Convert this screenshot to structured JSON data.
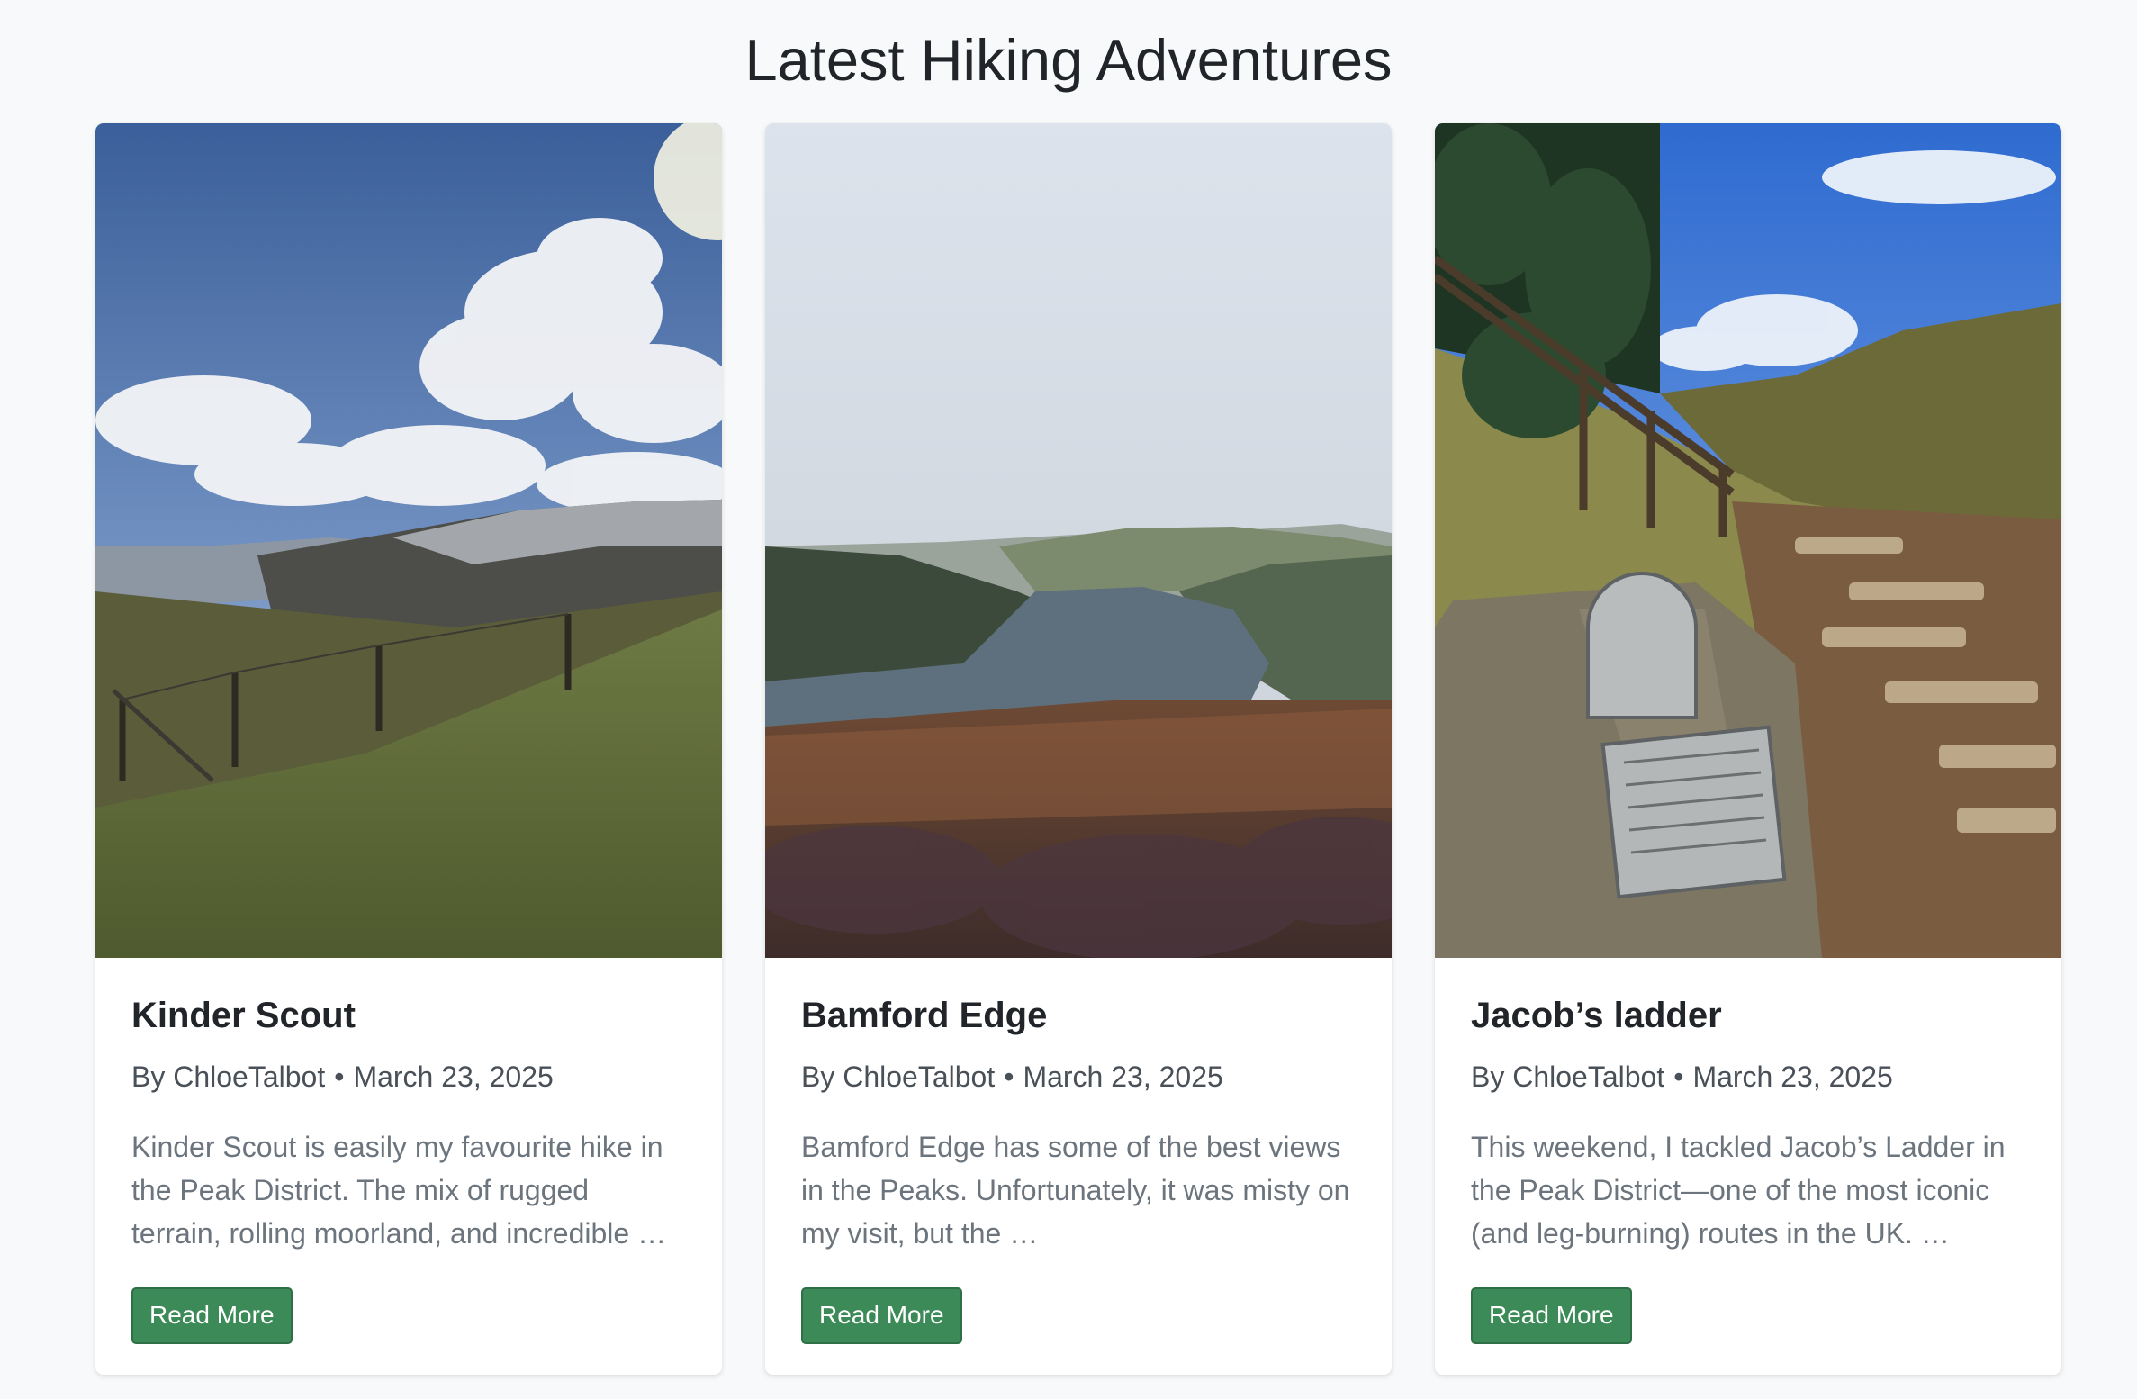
{
  "header": {
    "title": "Latest Hiking Adventures"
  },
  "posts": [
    {
      "title": "Kinder Scout",
      "by_label": "By",
      "author": "ChloeTalbot",
      "separator": "•",
      "date": "March 23, 2025",
      "excerpt": "Kinder Scout is easily my favourite hike in the Peak District. The mix of rugged terrain, rolling moorland, and incredible …",
      "button_label": "Read More",
      "image": "moorland-hills-cloudy-sky-photo"
    },
    {
      "title": "Bamford Edge",
      "by_label": "By",
      "author": "ChloeTalbot",
      "separator": "•",
      "date": "March 23, 2025",
      "excerpt": "Bamford Edge has some of the best views in the Peaks. Unfortunately, it was misty on my visit, but the …",
      "button_label": "Read More",
      "image": "misty-reservoir-valley-photo"
    },
    {
      "title": "Jacob’s ladder",
      "by_label": "By",
      "author": "ChloeTalbot",
      "separator": "•",
      "date": "March 23, 2025",
      "excerpt": "This weekend, I tackled Jacob’s Ladder in the Peak District—one of the most iconic (and leg-burning) routes in the UK. …",
      "button_label": "Read More",
      "image": "national-trust-stone-sign-path-photo"
    }
  ],
  "colors": {
    "button_bg": "#3c8a57",
    "page_bg": "#f8f9fa"
  }
}
